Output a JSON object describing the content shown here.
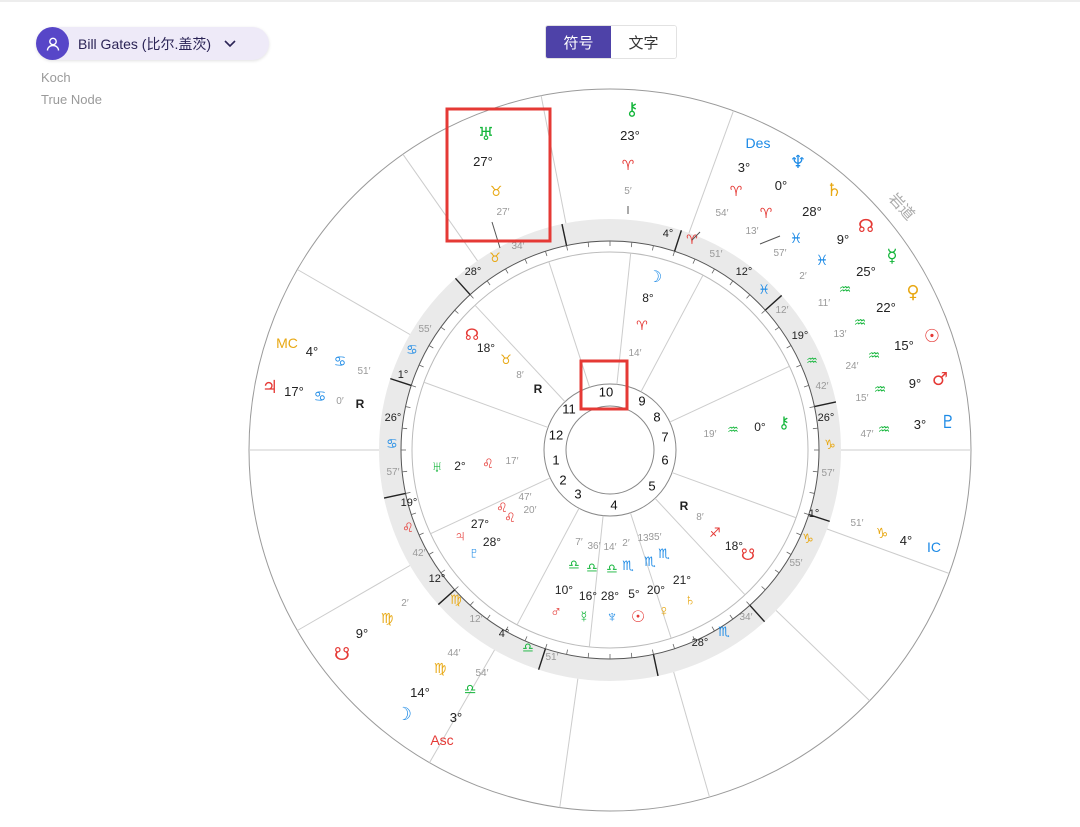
{
  "header": {
    "person_name": "Bill Gates (比尔.盖茨)",
    "house_system": "Koch",
    "node_type": "True Node"
  },
  "view_toggle": {
    "options": [
      "符号",
      "文字"
    ],
    "selected": "符号"
  },
  "colors": {
    "fire": "#e53935",
    "earth": "#e8a813",
    "air": "#13b53a",
    "water": "#1c8ae6",
    "highlight": "#e53935",
    "ring": "#eaeaea",
    "line": "#cccccc",
    "tick": "#222222"
  },
  "diagram": {
    "icon_names": {
      "person": "user-icon",
      "dropdown": "chevron-down-icon"
    },
    "ring_label": "岩道",
    "houses_inner": [
      "1",
      "2",
      "3",
      "4",
      "5",
      "6",
      "7",
      "8",
      "9",
      "10",
      "11",
      "12"
    ],
    "retrograde_mark": "R",
    "inner_chart_cusps": [
      {
        "deg": "28°",
        "sign": "♉",
        "min": "34′"
      },
      {
        "deg": "4°",
        "sign": "♈",
        "min": "51′"
      },
      {
        "deg": "12°",
        "sign": "♓",
        "min": "12′"
      },
      {
        "deg": "19°",
        "sign": "♒",
        "min": "42′"
      },
      {
        "deg": "26°",
        "sign": "♑",
        "min": "57′"
      },
      {
        "deg": "1°",
        "sign": "♑",
        "min": "55′"
      },
      {
        "deg": "28°",
        "sign": "♏",
        "min": "34′"
      },
      {
        "deg": "4°",
        "sign": "♎",
        "min": "51′"
      },
      {
        "deg": "12°",
        "sign": "♍",
        "min": "12′"
      },
      {
        "deg": "19°",
        "sign": "♌",
        "min": "42′"
      },
      {
        "deg": "26°",
        "sign": "♋",
        "min": "57′"
      },
      {
        "deg": "1°",
        "sign": "♋",
        "min": "55′"
      }
    ],
    "inner_planets": [
      {
        "glyph": "☽",
        "sign": "♈",
        "deg": "8°",
        "min": "14′"
      },
      {
        "glyph": "☊",
        "sign": "♉",
        "deg": "18°",
        "min": "8′"
      },
      {
        "glyph": "♅",
        "sign": "♌",
        "deg": "2°",
        "min": "17′"
      },
      {
        "glyph": "♃",
        "sign": "♌",
        "deg": "27°",
        "min": "47′"
      },
      {
        "glyph": "♇",
        "sign": "♌",
        "deg": "28°",
        "min": "20′"
      },
      {
        "glyph": "♂",
        "sign": "♎",
        "deg": "10°",
        "min": "7′"
      },
      {
        "glyph": "☿",
        "sign": "♎",
        "deg": "16°",
        "min": "36′"
      },
      {
        "glyph": "♆",
        "sign": "♎",
        "deg": "28°",
        "min": "14′"
      },
      {
        "glyph": "☉",
        "sign": "♏",
        "deg": "5°",
        "min": "2′"
      },
      {
        "glyph": "♀",
        "sign": "♏",
        "deg": "20°",
        "min": "13′"
      },
      {
        "glyph": "♄",
        "sign": "♏",
        "deg": "21°",
        "min": "35′"
      },
      {
        "glyph": "☋",
        "sign": "♐",
        "deg": "18°",
        "min": "8′"
      },
      {
        "glyph": "⚷",
        "sign": "♒",
        "deg": "0°",
        "min": "19′"
      }
    ],
    "outer_points": [
      {
        "glyph": "⚷",
        "sign": "♈",
        "deg": "23°",
        "min": "5′"
      },
      {
        "glyph": "♅",
        "sign": "♉",
        "deg": "27°",
        "min": "27′"
      },
      {
        "glyph": "Des",
        "sign": "♈",
        "deg": "3°",
        "min": "54′"
      },
      {
        "glyph": "♆",
        "sign": "♈",
        "deg": "0°",
        "min": "13′"
      },
      {
        "glyph": "♄",
        "sign": "♓",
        "deg": "28°",
        "min": "57′"
      },
      {
        "glyph": "☊",
        "sign": "♓",
        "deg": "9°",
        "min": "2′"
      },
      {
        "glyph": "☿",
        "sign": "♒",
        "deg": "25°",
        "min": "11′"
      },
      {
        "glyph": "♀",
        "sign": "♒",
        "deg": "22°",
        "min": "13′"
      },
      {
        "glyph": "☉",
        "sign": "♒",
        "deg": "15°",
        "min": "24′"
      },
      {
        "glyph": "♂",
        "sign": "♒",
        "deg": "9°",
        "min": "15′"
      },
      {
        "glyph": "♇",
        "sign": "♒",
        "deg": "3°",
        "min": "47′"
      },
      {
        "glyph": "IC",
        "sign": "♑",
        "deg": "4°",
        "min": "51′"
      },
      {
        "glyph": "MC",
        "sign": "♋",
        "deg": "4°",
        "min": "51′"
      },
      {
        "glyph": "♃",
        "sign": "♋",
        "deg": "17°",
        "min": "0′"
      },
      {
        "glyph": "☋",
        "sign": "♍",
        "deg": "9°",
        "min": "2′"
      },
      {
        "glyph": "☽",
        "sign": "♍",
        "deg": "14°",
        "min": "44′"
      },
      {
        "glyph": "Asc",
        "sign": "♎",
        "deg": "3°",
        "min": "54′"
      }
    ]
  }
}
